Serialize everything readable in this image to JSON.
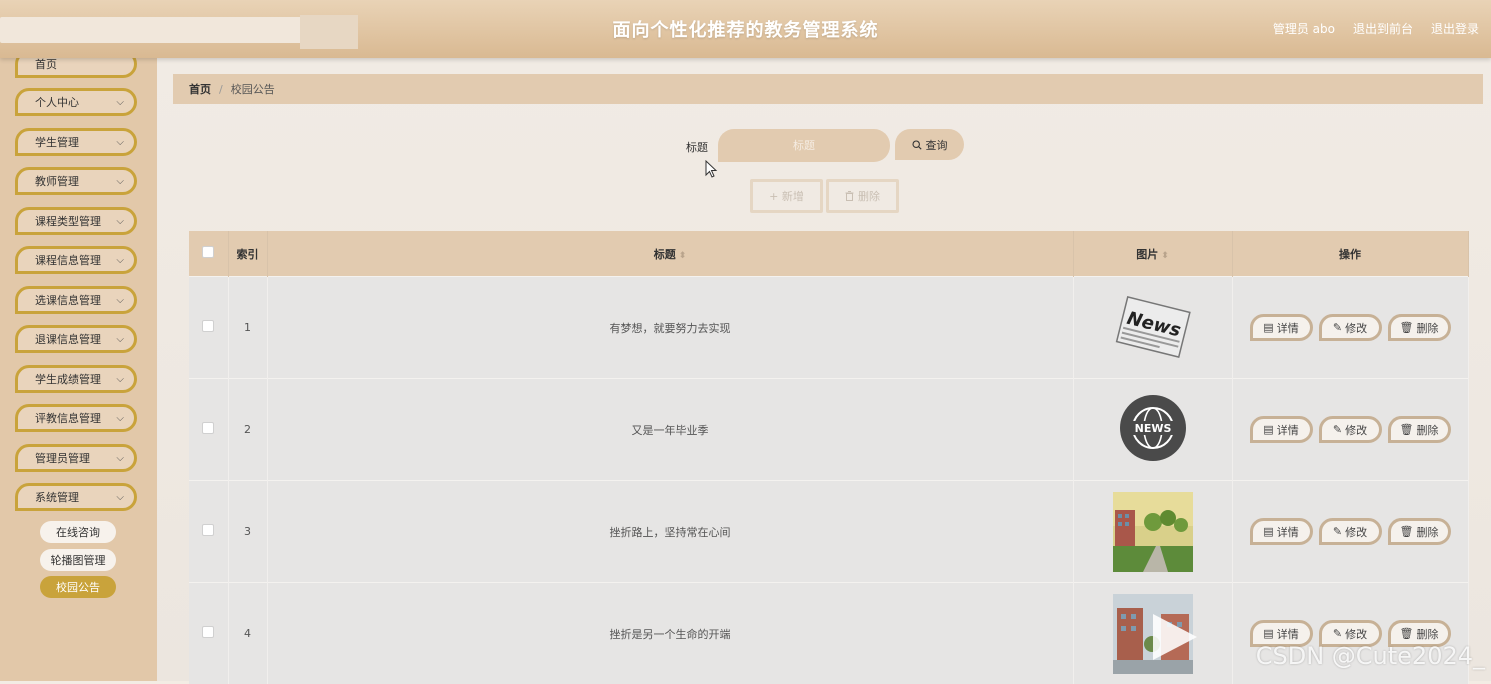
{
  "header": {
    "title": "面向个性化推荐的教务管理系统",
    "user": "管理员 abo",
    "front_link": "退出到前台",
    "logout_link": "退出登录"
  },
  "sidebar": {
    "items": [
      {
        "label": "首页"
      },
      {
        "label": "个人中心"
      },
      {
        "label": "学生管理"
      },
      {
        "label": "教师管理"
      },
      {
        "label": "课程类型管理"
      },
      {
        "label": "课程信息管理"
      },
      {
        "label": "选课信息管理"
      },
      {
        "label": "退课信息管理"
      },
      {
        "label": "学生成绩管理"
      },
      {
        "label": "评教信息管理"
      },
      {
        "label": "管理员管理"
      },
      {
        "label": "系统管理"
      }
    ],
    "subitems": [
      {
        "label": "在线咨询",
        "active": false
      },
      {
        "label": "轮播图管理",
        "active": false
      },
      {
        "label": "校园公告",
        "active": true
      }
    ]
  },
  "breadcrumb": {
    "home": "首页",
    "separator": "/",
    "current": "校园公告"
  },
  "search": {
    "label": "标题",
    "placeholder": "标题",
    "button": "查询"
  },
  "actions": {
    "add": "+ 新增",
    "delete": "删除"
  },
  "table": {
    "headers": {
      "index": "索引",
      "title": "标题",
      "image": "图片",
      "ops": "操作"
    },
    "rows": [
      {
        "index": "1",
        "title": "有梦想，就要努力去实现",
        "image": "news-paper-image"
      },
      {
        "index": "2",
        "title": "又是一年毕业季",
        "image": "news-globe-image"
      },
      {
        "index": "3",
        "title": "挫折路上，坚持常在心间",
        "image": "campus-road-image"
      },
      {
        "index": "4",
        "title": "挫折是另一个生命的开端",
        "image": "campus-building-image"
      }
    ],
    "ops": {
      "detail": "详情",
      "edit": "修改",
      "remove": "删除"
    }
  },
  "watermark": "CSDN @Cute2024_",
  "colors": {
    "accent": "#c9a33b",
    "header": "#d9b992",
    "sidebar": "#e2c8a9",
    "table_header": "#e2cbb0"
  }
}
